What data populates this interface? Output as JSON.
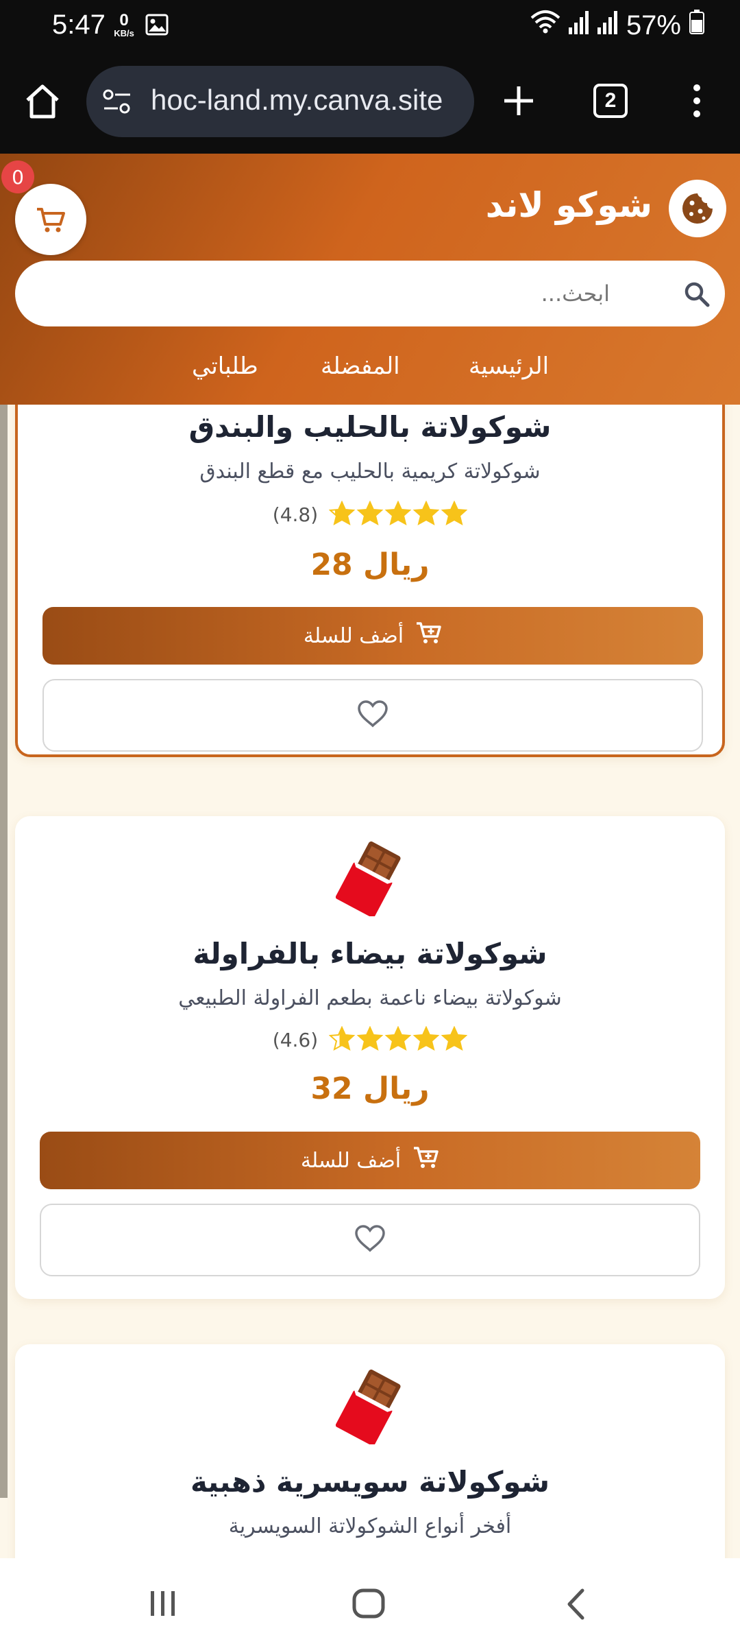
{
  "status_bar": {
    "time": "5:47",
    "net_speed_value": "0",
    "net_speed_unit": "KB/s",
    "battery": "57%"
  },
  "browser": {
    "url": "hoc-land.my.canva.site",
    "tab_count": "2"
  },
  "site": {
    "brand": "شوكو لاند",
    "cart_count": "0",
    "search_placeholder": "ابحث...",
    "nav": {
      "home": "الرئيسية",
      "favorites": "المفضلة",
      "orders": "طلباتي"
    }
  },
  "products": [
    {
      "title": "شوكولاتة بالحليب والبندق",
      "desc": "شوكولاتة كريمية بالحليب مع قطع البندق",
      "rating": "(4.8)",
      "rating_value": 4.8,
      "price": "28 ريال",
      "add_label": "أضف للسلة"
    },
    {
      "title": "شوكولاتة بيضاء بالفراولة",
      "desc": "شوكولاتة بيضاء ناعمة بطعم الفراولة الطبيعي",
      "rating": "(4.6)",
      "rating_value": 4.6,
      "price": "32 ريال",
      "add_label": "أضف للسلة"
    },
    {
      "title": "شوكولاتة سويسرية ذهبية",
      "desc": "أفخر أنواع الشوكولاتة السويسرية"
    }
  ],
  "colors": {
    "brand_orange": "#cf641d",
    "price": "#c8700f",
    "star": "#f7c31a"
  }
}
